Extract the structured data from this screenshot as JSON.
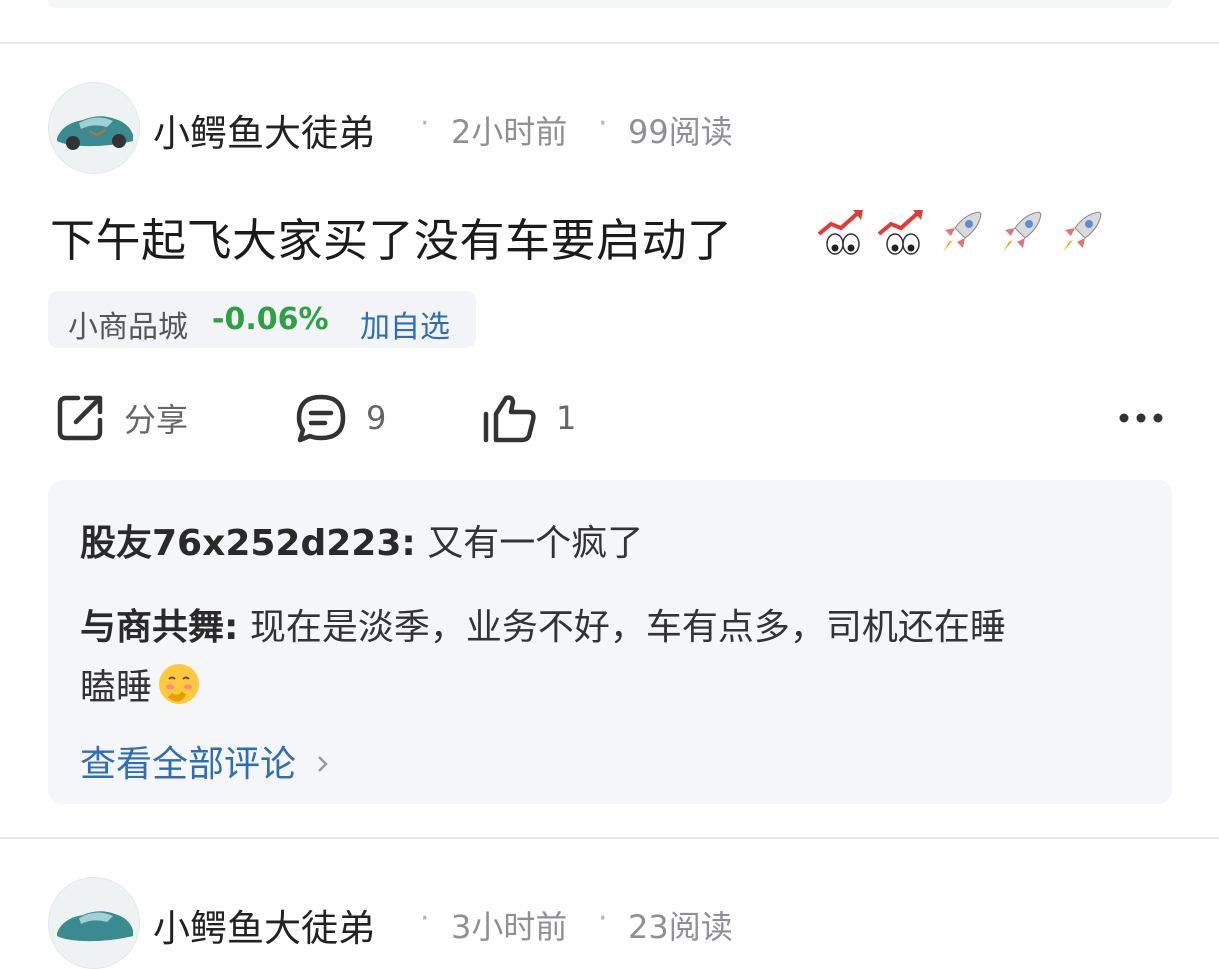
{
  "posts": [
    {
      "author": "小鳄鱼大徒弟",
      "time": "2小时前",
      "reads": "99阅读",
      "content": "下午起飞大家买了没有车要启动了",
      "emojis": [
        "chart-up-eyes-emoji",
        "chart-up-eyes-emoji",
        "rocket-emoji",
        "rocket-emoji",
        "rocket-emoji"
      ],
      "stock": {
        "name": "小商品城",
        "change": "-0.06%",
        "add_label": "加自选"
      },
      "actions": {
        "share_label": "分享",
        "comment_count": "9",
        "like_count": "1"
      },
      "comments": [
        {
          "user": "股友76x252d223",
          "sep": ":",
          "text": "又有一个疯了"
        },
        {
          "user": "与商共舞",
          "sep": ":",
          "text": "现在是淡季，业务不好，车有点多，司机还在睡",
          "text2": "瞌睡"
        }
      ],
      "view_all": "查看全部评论"
    },
    {
      "author": "小鳄鱼大徒弟",
      "time": "3小时前",
      "reads": "23阅读"
    }
  ],
  "colors": {
    "stock_change": "#2ea043",
    "link": "#2f6db5",
    "meta": "#8f8f95"
  }
}
